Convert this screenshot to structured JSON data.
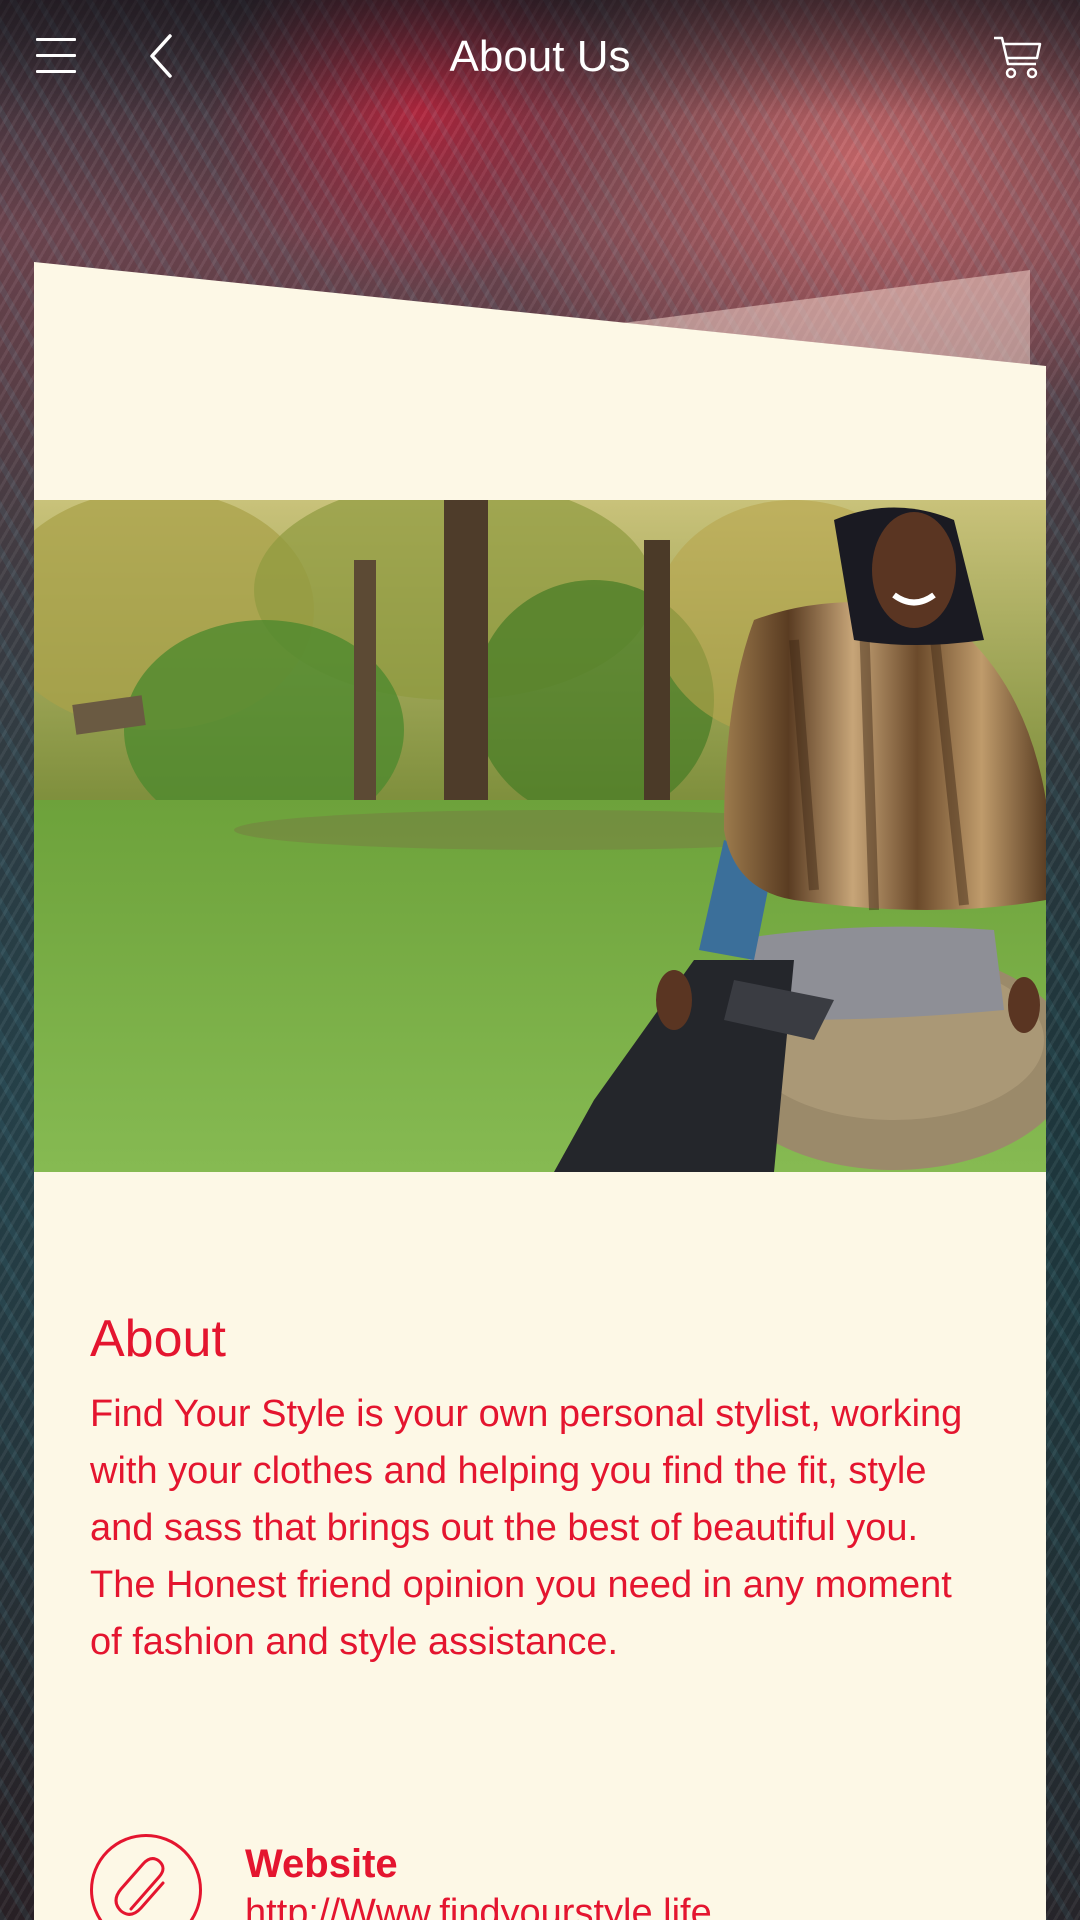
{
  "header": {
    "title": "About Us",
    "menu_icon": "hamburger-menu-icon",
    "back_icon": "chevron-left-icon",
    "cart_icon": "shopping-cart-icon"
  },
  "about": {
    "heading": "About",
    "body": "Find Your Style is your own personal stylist, working with your clothes and helping you find the fit, style and sass that brings out the best of beautiful you. The Honest friend opinion you need in any moment of fashion and style assistance."
  },
  "website": {
    "icon": "paperclip-icon",
    "label": "Website",
    "url": "http://Www.findyourstyle.life"
  },
  "colors": {
    "accent": "#e4152f",
    "card_background": "#fdf8e6",
    "header_text": "#ffffff"
  }
}
